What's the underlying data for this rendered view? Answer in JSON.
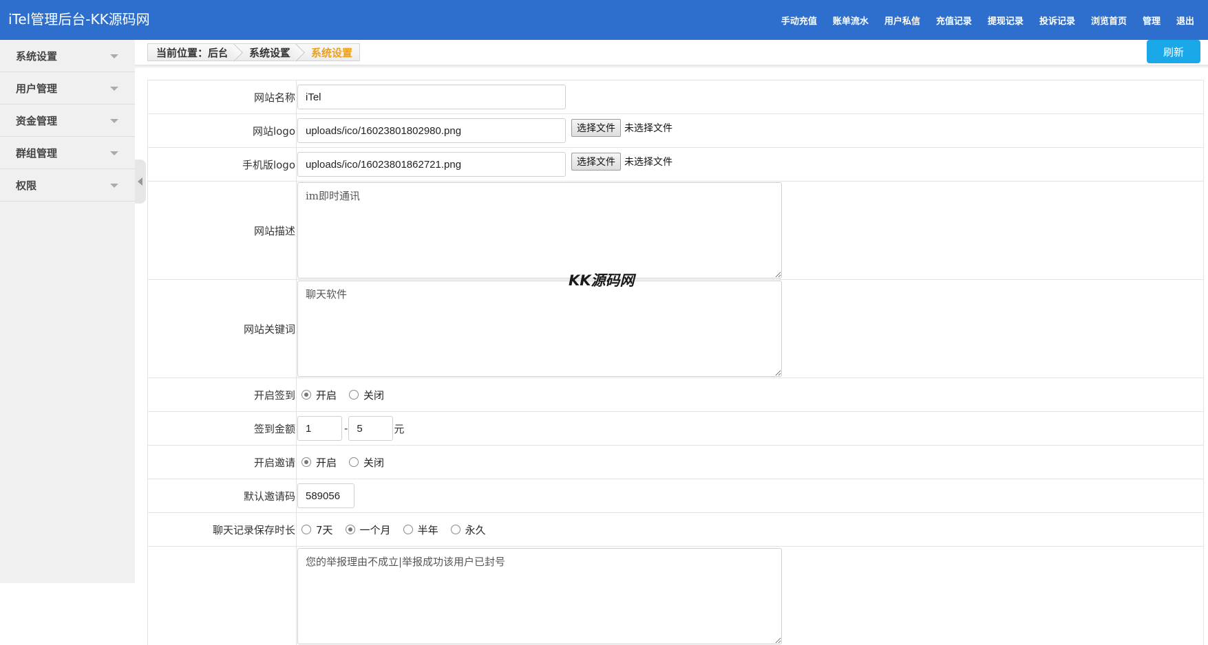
{
  "app": {
    "title": "iTel管理后台-KK源码网"
  },
  "topnav": [
    "手动充值",
    "账单流水",
    "用户私信",
    "充值记录",
    "提现记录",
    "投诉记录",
    "浏览首页",
    "管理",
    "退出"
  ],
  "sidebar": [
    {
      "label": "系统设置"
    },
    {
      "label": "用户管理"
    },
    {
      "label": "资金管理"
    },
    {
      "label": "群组管理"
    },
    {
      "label": "权限"
    }
  ],
  "breadcrumb": {
    "prefix": "当前位置：后台",
    "level1": "系统设置",
    "level2": "系统设置"
  },
  "refresh_label": "刷新",
  "form": {
    "site_name": {
      "label": "网站名称",
      "value": "iTel"
    },
    "site_logo": {
      "label": "网站logo",
      "value": "uploads/ico/16023801802980.png",
      "button": "选择文件",
      "status": "未选择文件"
    },
    "mobile_logo": {
      "label": "手机版logo",
      "value": "uploads/ico/16023801862721.png",
      "button": "选择文件",
      "status": "未选择文件"
    },
    "site_desc": {
      "label": "网站描述",
      "value": "im即时通讯"
    },
    "site_keywords": {
      "label": "网站关键词",
      "value": "聊天软件"
    },
    "checkin": {
      "label": "开启签到",
      "options": [
        "开启",
        "关闭"
      ],
      "selected": 0
    },
    "checkin_amount": {
      "label": "签到金额",
      "min": "1",
      "dash": "-",
      "max": "5",
      "unit": "元"
    },
    "invite": {
      "label": "开启邀请",
      "options": [
        "开启",
        "关闭"
      ],
      "selected": 0
    },
    "invite_code": {
      "label": "默认邀请码",
      "value": "589056"
    },
    "chat_retention": {
      "label": "聊天记录保存时长",
      "options": [
        "7天",
        "一个月",
        "半年",
        "永久"
      ],
      "selected": 1
    },
    "report_reply": {
      "label": "",
      "value": "您的举报理由不成立|举报成功该用户已封号"
    }
  },
  "watermark": "KK源码网"
}
